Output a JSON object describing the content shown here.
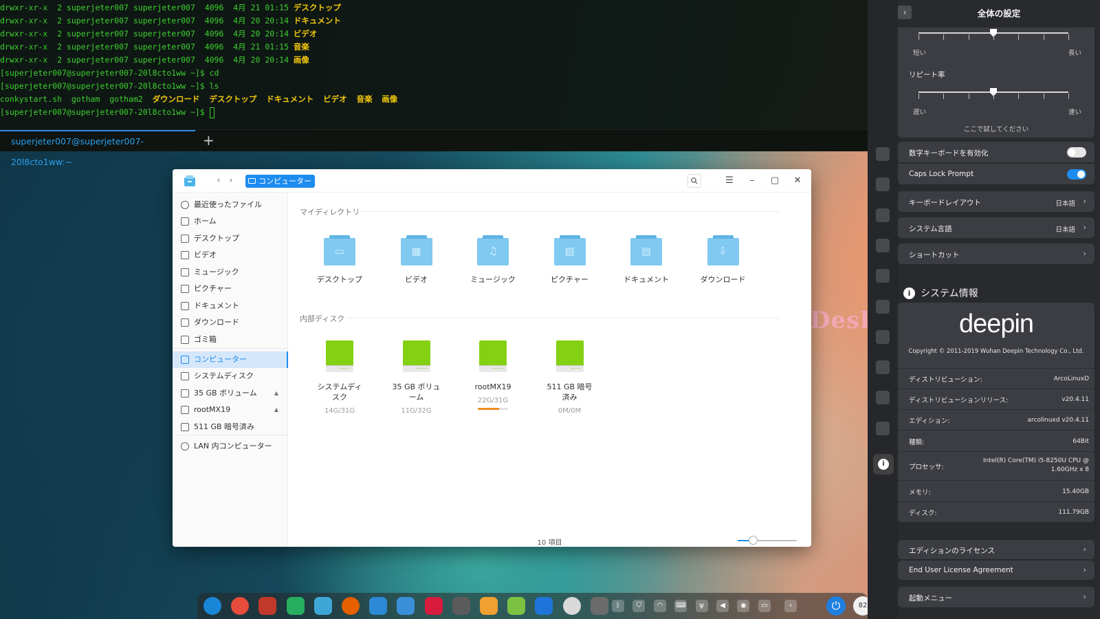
{
  "terminal": {
    "lines": [
      {
        "prefix": "drwxr-xr-x  2 superjeter007 superjeter007  4096  4月 21 01:15 ",
        "highlight": "デスクトップ"
      },
      {
        "prefix": "drwxr-xr-x  2 superjeter007 superjeter007  4096  4月 20 20:14 ",
        "highlight": "ドキュメント"
      },
      {
        "prefix": "drwxr-xr-x  2 superjeter007 superjeter007  4096  4月 20 20:14 ",
        "highlight": "ビデオ"
      },
      {
        "prefix": "drwxr-xr-x  2 superjeter007 superjeter007  4096  4月 21 01:15 ",
        "highlight": "音楽"
      },
      {
        "prefix": "drwxr-xr-x  2 superjeter007 superjeter007  4096  4月 20 20:14 ",
        "highlight": "画像"
      },
      {
        "prefix": "[superjeter007@superjeter007-20l8cto1ww ~]$ cd",
        "highlight": ""
      },
      {
        "prefix": "[superjeter007@superjeter007-20l8cto1ww ~]$ ls",
        "highlight": ""
      },
      {
        "prefix": "conkystart.sh  gotham  gotham2  ",
        "highlight": "ダウンロード  デスクトップ  ドキュメント  ビデオ  音楽  画像"
      },
      {
        "prefix": "[superjeter007@superjeter007-20l8cto1ww ~]$ ",
        "highlight": ""
      }
    ],
    "tab_title": "superjeter007@superjeter007-20l8cto1ww:~",
    "add_tab": "+"
  },
  "wallpaper": {
    "desk_text": "Desk"
  },
  "file_manager": {
    "breadcrumb": "コンピューター",
    "sidebar": [
      {
        "label": "最近使ったファイル",
        "icon": "clock-icon"
      },
      {
        "label": "ホーム",
        "icon": "home-icon"
      },
      {
        "label": "デスクトップ",
        "icon": "desktop-icon"
      },
      {
        "label": "ビデオ",
        "icon": "video-icon"
      },
      {
        "label": "ミュージック",
        "icon": "music-icon"
      },
      {
        "label": "ピクチャー",
        "icon": "picture-icon"
      },
      {
        "label": "ドキュメント",
        "icon": "document-icon"
      },
      {
        "label": "ダウンロード",
        "icon": "download-icon"
      },
      {
        "label": "ゴミ箱",
        "icon": "trash-icon"
      },
      {
        "label": "コンピューター",
        "icon": "computer-icon"
      },
      {
        "label": "システムディスク",
        "icon": "disk-icon"
      },
      {
        "label": "35 GB ボリューム",
        "icon": "disk-icon"
      },
      {
        "label": "rootMX19",
        "icon": "disk-icon"
      },
      {
        "label": "511 GB 暗号済み",
        "icon": "disk-icon"
      },
      {
        "label": "LAN 内コンピューター",
        "icon": "network-icon"
      }
    ],
    "my_dirs_title": "マイディレクトリ",
    "folders": [
      {
        "label": "デスクトップ",
        "glyph": "▭"
      },
      {
        "label": "ビデオ",
        "glyph": "▦"
      },
      {
        "label": "ミュージック",
        "glyph": "♫"
      },
      {
        "label": "ピクチャー",
        "glyph": "▨"
      },
      {
        "label": "ドキュメント",
        "glyph": "▤"
      },
      {
        "label": "ダウンロード",
        "glyph": "⇩"
      }
    ],
    "disks_title": "内部ディスク",
    "disks": [
      {
        "label": "システムディスク",
        "usage": "14G/31G"
      },
      {
        "label": "35 GB ボリューム",
        "usage": "11G/32G"
      },
      {
        "label": "rootMX19",
        "usage": "22G/31G",
        "fill_fraction": 0.71
      },
      {
        "label": "511 GB 暗号済み",
        "usage": "0M/0M"
      }
    ],
    "status": "10 項目",
    "zoom_fraction": 0.25
  },
  "control_center": {
    "title": "全体の設定",
    "repeat_delay": {
      "min_label": "短い",
      "max_label": "長い",
      "fraction": 0.5
    },
    "repeat_rate": {
      "title": "リピート率",
      "min_label": "遅い",
      "max_label": "速い",
      "fraction": 0.5,
      "test_hint": "ここで試してください"
    },
    "numlock_label": "数字キーボードを有効化",
    "capslock_label": "Caps Lock Prompt",
    "keyboard_layout": {
      "label": "キーボードレイアウト",
      "value": "日本語"
    },
    "system_language": {
      "label": "システム言語",
      "value": "日本語"
    },
    "shortcuts_label": "ショートカット",
    "sysinfo_title": "システム情報",
    "logo": "deepin",
    "copyright": "Copyright © 2011-2019 Wuhan Deepin Technology Co., Ltd.",
    "info": [
      {
        "key": "ディストリビューション:",
        "value": "ArcoLinuxD"
      },
      {
        "key": "ディストリビューションリリース:",
        "value": "v20.4.11"
      },
      {
        "key": "エディション:",
        "value": "arcolinuxd v20.4.11"
      },
      {
        "key": "種類:",
        "value": "64Bit"
      },
      {
        "key": "プロセッサ:",
        "value": "Intel(R) Core(TM) i5-8250U CPU @",
        "value2": "1.60GHz x 8"
      },
      {
        "key": "メモリ:",
        "value": "15.40GB"
      },
      {
        "key": "ディスク:",
        "value": "111.79GB"
      }
    ],
    "license_label": "エディションのライセンス",
    "eula_label": "End User License Agreement",
    "boot_menu_label": "起動メニュー"
  },
  "dock": {
    "apps": [
      {
        "name": "launcher-icon",
        "color": "#1a86d8"
      },
      {
        "name": "screen-recorder-icon",
        "color": "#e74c3c"
      },
      {
        "name": "terminal-icon",
        "color": "#c0392b"
      },
      {
        "name": "text-editor-icon",
        "color": "#27ae60"
      },
      {
        "name": "file-manager-icon",
        "color": "#3ea7d8"
      },
      {
        "name": "firefox-icon",
        "color": "#e66000"
      },
      {
        "name": "mail-icon",
        "color": "#2c89d6"
      },
      {
        "name": "settings-app-icon",
        "color": "#3a8fd8"
      },
      {
        "name": "screenshot-icon",
        "color": "#d81b3c"
      },
      {
        "name": "joystick-icon",
        "color": "#5b5b5b"
      },
      {
        "name": "image-viewer-icon",
        "color": "#f0a030"
      },
      {
        "name": "music-app-icon",
        "color": "#7cc242"
      },
      {
        "name": "movie-icon",
        "color": "#1e74d8"
      },
      {
        "name": "control-center-icon",
        "color": "#d9d9d9"
      },
      {
        "name": "multitask-icon",
        "color": "#6b6b6b"
      }
    ],
    "tray": [
      "bluetooth-icon",
      "shield-icon",
      "wifi-icon",
      "keyboard-icon",
      "usb-icon",
      "volume-icon",
      "network-icon",
      "battery-icon",
      "chevron-left-icon"
    ],
    "user_badge": "82"
  }
}
